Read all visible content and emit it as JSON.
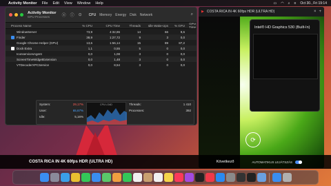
{
  "menubar": {
    "app_name": "Activity Monitor",
    "items": [
      "File",
      "Edit",
      "View",
      "Window",
      "Help"
    ],
    "datetime": "Oct 30., Fri  19:14"
  },
  "activity_monitor": {
    "title": "Activity Monitor",
    "subtitle": "GPU Processes",
    "tabs": [
      "CPU",
      "Memory",
      "Energy",
      "Disk",
      "Network"
    ],
    "active_tab": "CPU",
    "columns": [
      "Process Name",
      "% CPU",
      "CPU Time",
      "Threads",
      "Idle Wake-Ups",
      "% GPU",
      "GPU Time"
    ],
    "rows": [
      {
        "name": "WindowServer",
        "cpu": "73,9",
        "time": "4:32,86",
        "threads": "14",
        "idle": "66",
        "gpu": "9,6",
        "gput": "",
        "icon": "none"
      },
      {
        "name": "Finder",
        "cpu": "38,9",
        "time": "1:27,72",
        "threads": "9",
        "idle": "3",
        "gpu": "0,0",
        "gput": "",
        "icon": "finder"
      },
      {
        "name": "Google Chrome Helper (GPU)",
        "cpu": "13,6",
        "time": "1:56,14",
        "threads": "15",
        "idle": "89",
        "gpu": "87,2",
        "gput": "",
        "icon": "none"
      },
      {
        "name": "Dock Extra",
        "cpu": "1,1",
        "time": "0,55",
        "threads": "5",
        "idle": "0",
        "gpu": "0,0",
        "gput": "",
        "icon": "dock"
      },
      {
        "name": "IconservicesAgent",
        "cpu": "0,0",
        "time": "1,08",
        "threads": "3",
        "idle": "0",
        "gpu": "0,0",
        "gput": "",
        "icon": "none"
      },
      {
        "name": "ScreenTimeWidgetExtension",
        "cpu": "0,0",
        "time": "1,48",
        "threads": "3",
        "idle": "0",
        "gpu": "0,0",
        "gput": "",
        "icon": "none"
      },
      {
        "name": "VTDecoderXPCService",
        "cpu": "0,0",
        "time": "8,54",
        "threads": "3",
        "idle": "0",
        "gpu": "0,0",
        "gput": "",
        "icon": "none"
      }
    ],
    "footer": {
      "system_label": "System:",
      "system_value": "29,17%",
      "user_label": "User:",
      "user_value": "65,67%",
      "idle_label": "Idle:",
      "idle_value": "5,16%",
      "graph_label": "CPU LOAD",
      "threads_label": "Threads:",
      "threads_value": "1 410",
      "processes_label": "Processes:",
      "processes_value": "392"
    }
  },
  "video_window": {
    "tab_title": "COSTA RICA IN 4K 60fps HDR (ULTRA HD)",
    "bar_title": "COSTA RICA IN 4K 60fps HDR (ULTRA HD)",
    "next_label": "Következő",
    "autoplay_label": "AUTOMATIKUS LEJÁTSZÁS"
  },
  "gpu_history": {
    "title": "Intel® HD Graphics 530 (Built-In)",
    "levels": [
      0.72,
      0.82,
      0.7,
      0.88
    ]
  },
  "dock_apps": [
    "finder",
    "launchpad",
    "safari",
    "chrome",
    "messages",
    "mail",
    "maps",
    "photos",
    "facetime",
    "calendar",
    "contacts",
    "reminders",
    "notes",
    "music",
    "podcasts",
    "tv",
    "news",
    "appstore",
    "settings",
    "activity",
    "terminal",
    "preview",
    "sep",
    "downloads",
    "trash"
  ],
  "colors": {
    "accent": "#4a8cf0",
    "system_red": "#ff5f57",
    "user_blue": "#4aa3ff"
  }
}
